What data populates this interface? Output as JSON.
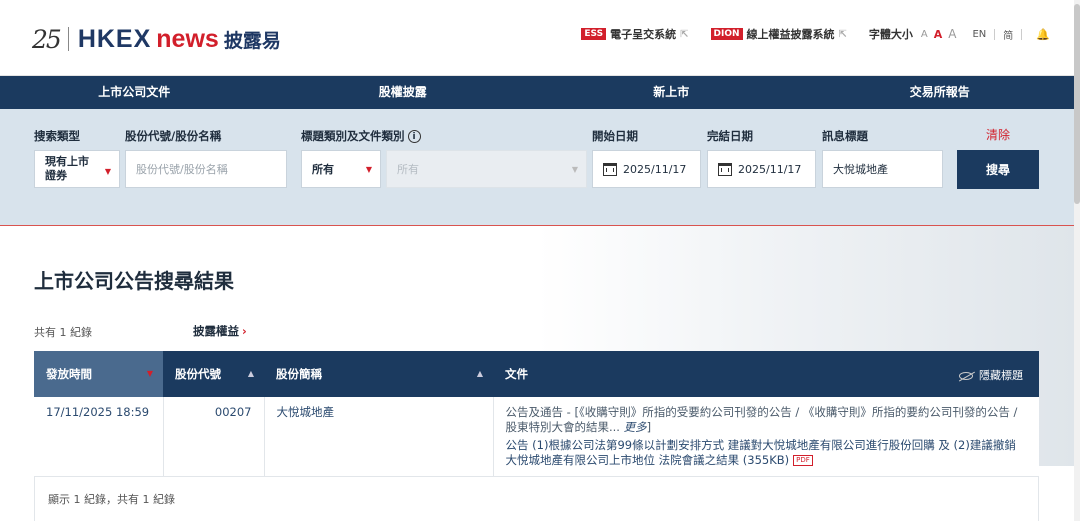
{
  "header": {
    "logo_num": "25",
    "logo_hkex": "HKEX",
    "logo_news": "news",
    "logo_cn": "披露易",
    "links": [
      {
        "tag": "ESS",
        "label": "電子呈交系統"
      },
      {
        "tag": "DION",
        "label": "線上權益披露系統"
      }
    ],
    "font_size_label": "字體大小",
    "font_sizes": [
      "A",
      "A",
      "A"
    ],
    "lang_en": "EN",
    "lang_cn": "简"
  },
  "nav": [
    "上市公司文件",
    "股權披露",
    "新上市",
    "交易所報告"
  ],
  "search": {
    "search_type_label": "搜索類型",
    "search_type_value": "現有上市證券",
    "stock_label": "股份代號/股份名稱",
    "stock_placeholder": "股份代號/股份名稱",
    "category_label": "標題類別及文件類別",
    "category_value": "所有",
    "doc_type_value": "所有",
    "start_label": "開始日期",
    "start_value": "2025/11/17",
    "end_label": "完結日期",
    "end_value": "2025/11/17",
    "title_label": "訊息標題",
    "title_value": "大悅城地產",
    "clear_label": "清除",
    "search_button": "搜尋"
  },
  "results": {
    "title": "上市公司公告搜尋結果",
    "count_text": "共有 1 紀錄",
    "disclosure_link": "披露權益",
    "columns": [
      "發放時間",
      "股份代號",
      "股份簡稱",
      "文件"
    ],
    "hide_title": "隱藏標題",
    "rows": [
      {
        "time": "17/11/2025 18:59",
        "code": "00207",
        "name": "大悅城地產",
        "category": "公告及通告 - [《收購守則》所指的受要約公司刊發的公告 / 《收購守則》所指的要約公司刊發的公告 / 股東特別大會的結果...",
        "more": "更多",
        "category_end": "]",
        "doc": "公告 (1)根據公司法第99條以計劃安排方式 建議對大悅城地產有限公司進行股份回購 及 (2)建議撤銷大悅城地產有限公司上市地位 法院會議之結果 (355KB)",
        "pdf": "PDF"
      }
    ],
    "footer_text": "顯示 1 紀錄，共有 1 紀錄"
  }
}
